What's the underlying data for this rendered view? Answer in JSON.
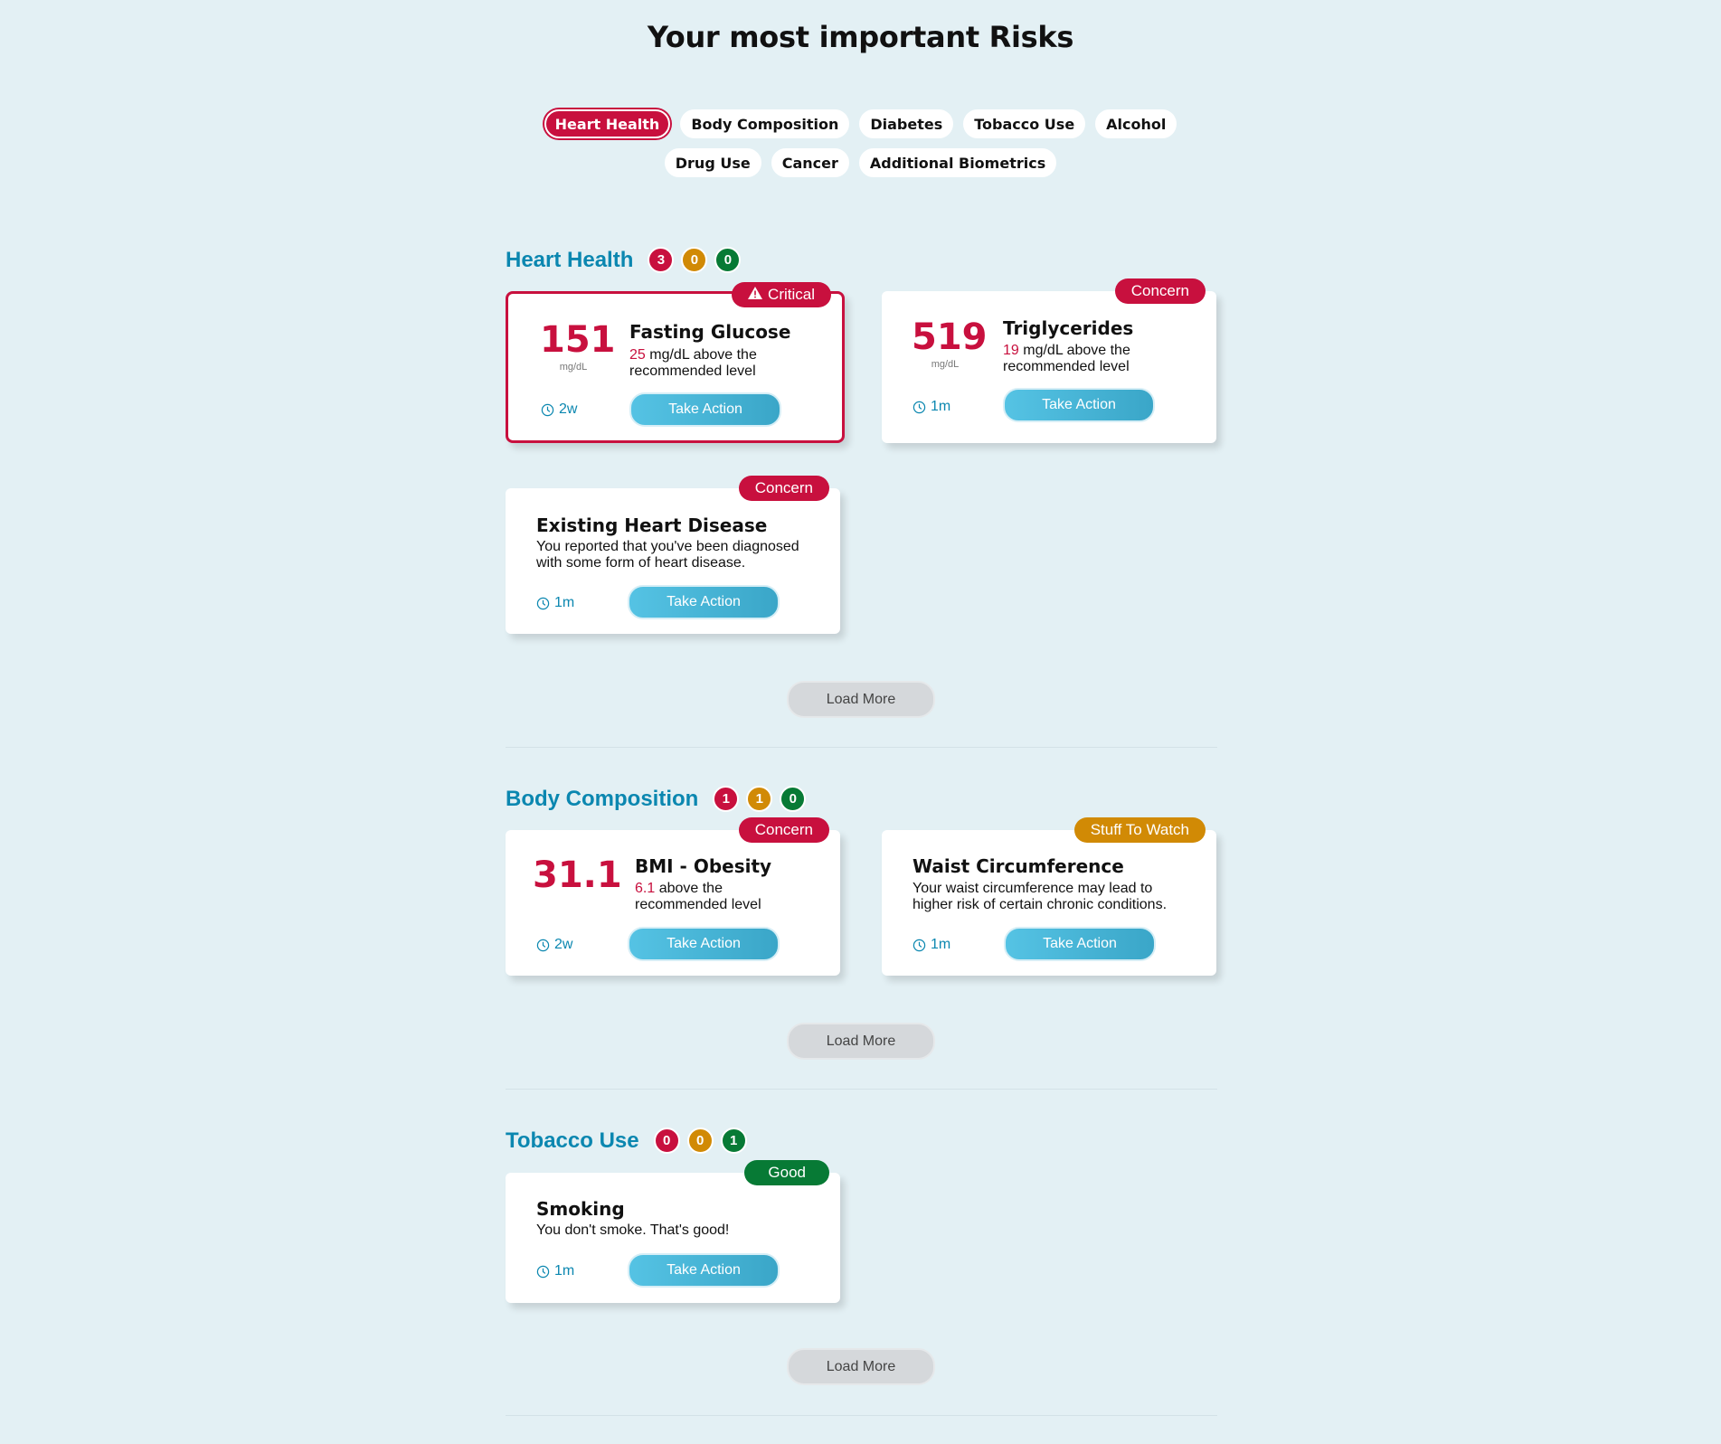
{
  "page_title": "Your most important Risks",
  "filters": {
    "row1": [
      "Heart Health",
      "Body Composition",
      "Diabetes",
      "Tobacco Use",
      "Alcohol"
    ],
    "row2": [
      "Drug Use",
      "Cancer",
      "Additional Biometrics"
    ],
    "active": "Heart Health"
  },
  "colors": {
    "critical": "#c8103e",
    "watch": "#d18a05",
    "good": "#077a35",
    "accent": "#0b87b0",
    "background": "#e3f0f4"
  },
  "sections": {
    "heart": {
      "title": "Heart Health",
      "counts": [
        "3",
        "0",
        "0"
      ],
      "cards": [
        {
          "badge": "Critical",
          "badge_icon": "warning-icon",
          "value": "151",
          "unit": "mg/dL",
          "title": "Fasting Glucose",
          "highlight": "25",
          "desc": " mg/dL above the recommended level",
          "time": "2w",
          "action": "Take Action"
        },
        {
          "badge": "Concern",
          "value": "519",
          "unit": "mg/dL",
          "title": "Triglycerides",
          "highlight": "19",
          "desc": " mg/dL above the recommended level",
          "time": "1m",
          "action": "Take Action"
        },
        {
          "badge": "Concern",
          "title": "Existing Heart Disease",
          "desc": "You reported that you've been diagnosed with some form of heart disease.",
          "time": "1m",
          "action": "Take Action"
        }
      ],
      "load_more": "Load More"
    },
    "body": {
      "title": "Body Composition",
      "counts": [
        "1",
        "1",
        "0"
      ],
      "cards": [
        {
          "badge": "Concern",
          "value": "31.1",
          "title": "BMI - Obesity",
          "highlight": "6.1",
          "desc": " above the recommended level",
          "time": "2w",
          "action": "Take Action"
        },
        {
          "badge": "Stuff To Watch",
          "title": "Waist Circumference",
          "desc": "Your waist circumference may lead to higher risk of certain chronic conditions.",
          "time": "1m",
          "action": "Take Action"
        }
      ],
      "load_more": "Load More"
    },
    "tobacco": {
      "title": "Tobacco Use",
      "counts": [
        "0",
        "0",
        "1"
      ],
      "cards": [
        {
          "badge": "Good",
          "title": "Smoking",
          "desc": "You don't smoke. That's good!",
          "time": "1m",
          "action": "Take Action"
        }
      ],
      "load_more": "Load More"
    }
  }
}
